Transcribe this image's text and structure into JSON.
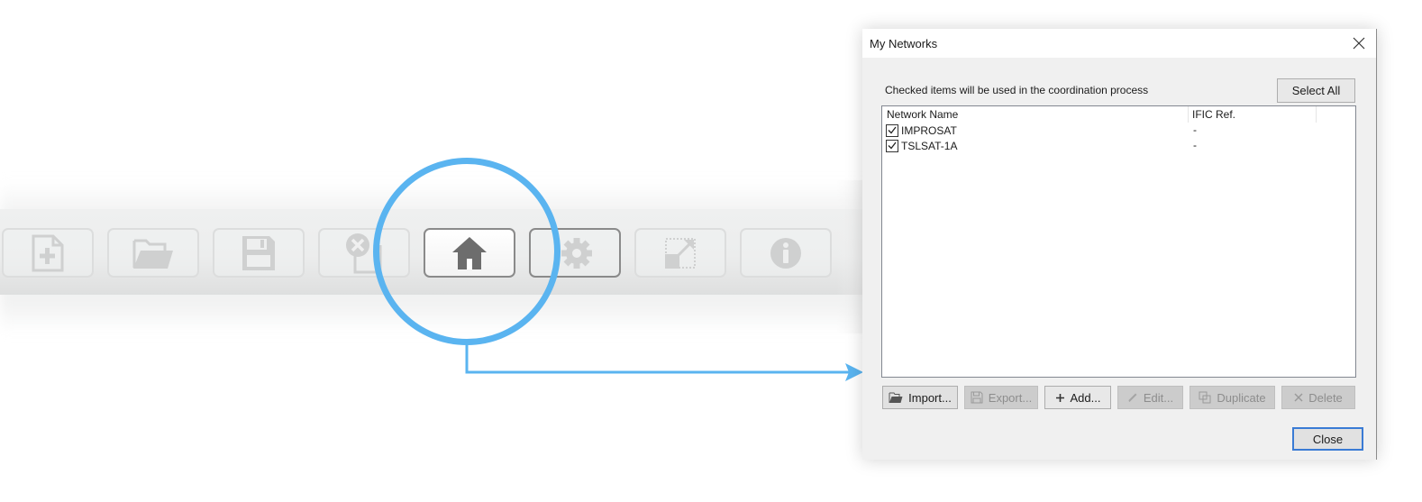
{
  "toolbar": {
    "buttons": [
      {
        "id": "new",
        "icon": "new-file-icon",
        "state": "disabled"
      },
      {
        "id": "open",
        "icon": "folder-open-icon",
        "state": "disabled"
      },
      {
        "id": "save",
        "icon": "save-icon",
        "state": "disabled"
      },
      {
        "id": "close",
        "icon": "close-file-icon",
        "state": "disabled"
      },
      {
        "id": "home",
        "icon": "home-icon",
        "state": "active"
      },
      {
        "id": "settings",
        "icon": "gear-icon",
        "state": "disabled"
      },
      {
        "id": "resize",
        "icon": "resize-icon",
        "state": "disabled"
      },
      {
        "id": "info",
        "icon": "info-icon",
        "state": "disabled"
      }
    ],
    "highlight_color": "#5ab4f0"
  },
  "dialog": {
    "title": "My Networks",
    "hint": "Checked items will be used in the coordination process",
    "select_all_label": "Select All",
    "columns": [
      "Network Name",
      "IFIC Ref."
    ],
    "rows": [
      {
        "name": "IMPROSAT",
        "ific": "-",
        "checked": true
      },
      {
        "name": "TSLSAT-1A",
        "ific": "-",
        "checked": true
      }
    ],
    "actions": [
      {
        "label": "Import...",
        "icon": "folder-open-icon",
        "enabled": true
      },
      {
        "label": "Export...",
        "icon": "save-icon",
        "enabled": false
      },
      {
        "label": "Add...",
        "icon": "plus-icon",
        "enabled": true
      },
      {
        "label": "Edit...",
        "icon": "pencil-icon",
        "enabled": false
      },
      {
        "label": "Duplicate",
        "icon": "duplicate-icon",
        "enabled": false
      },
      {
        "label": "Delete",
        "icon": "delete-icon",
        "enabled": false
      }
    ],
    "close_label": "Close",
    "accent_color": "#3a7bd5"
  }
}
